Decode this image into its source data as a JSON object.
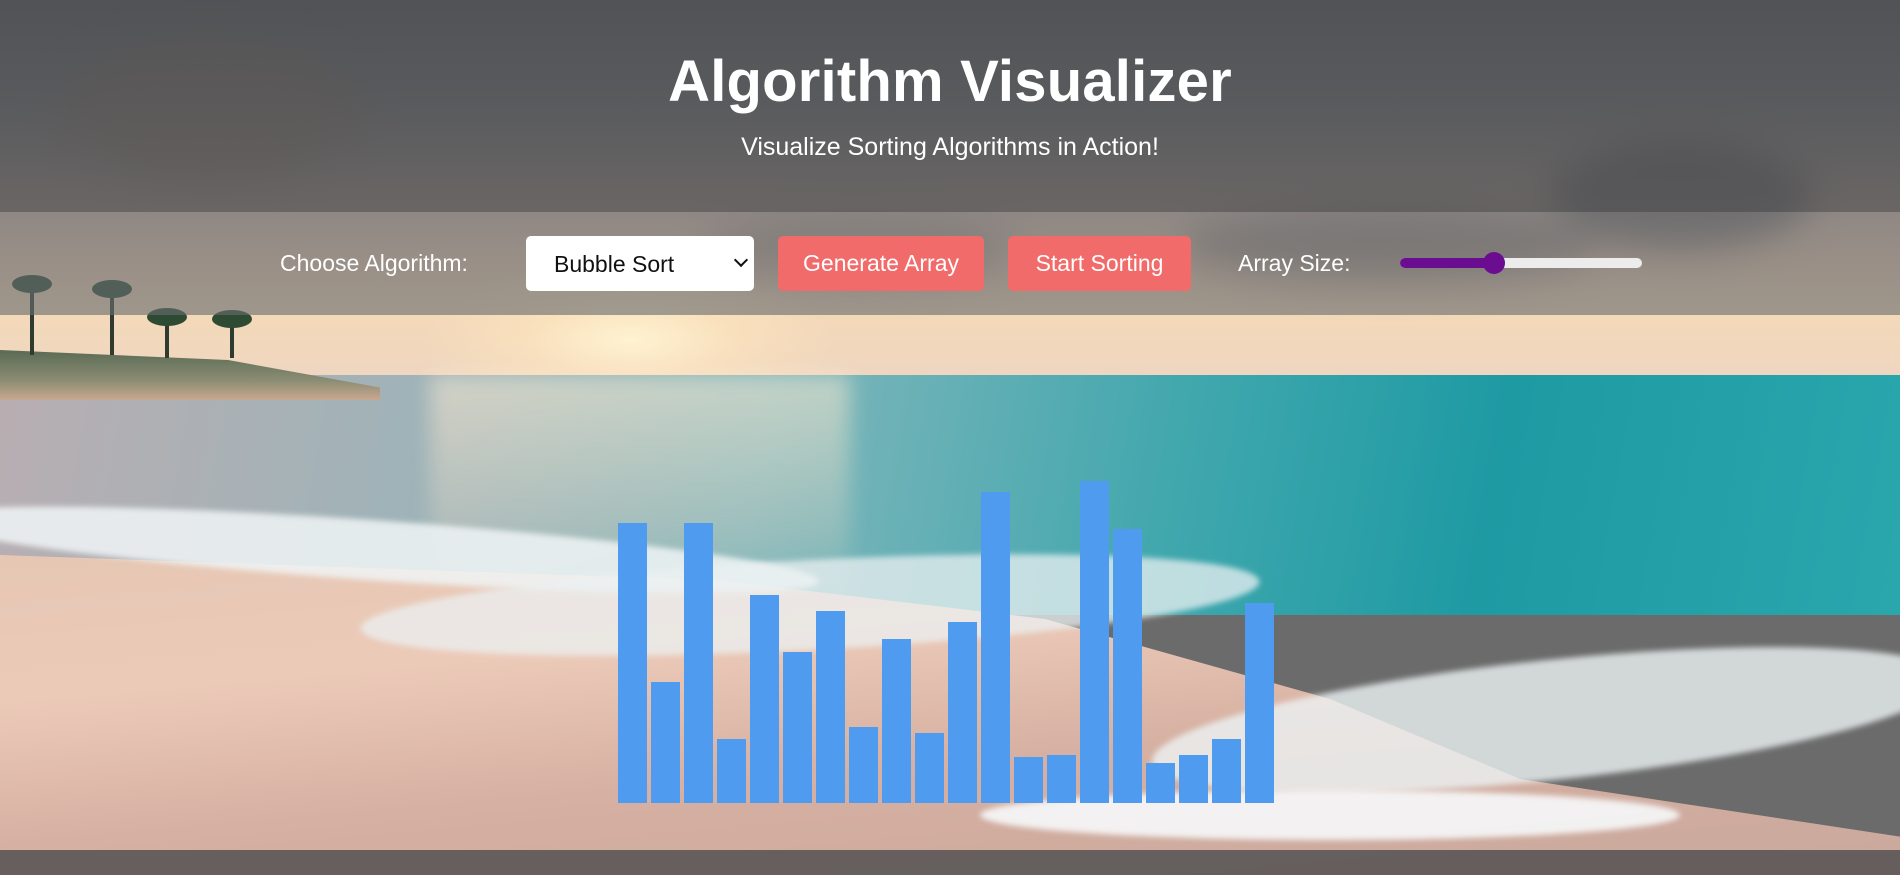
{
  "header": {
    "title": "Algorithm Visualizer",
    "subtitle": "Visualize Sorting Algorithms in Action!"
  },
  "controls": {
    "algorithm_label": "Choose Algorithm:",
    "algorithm_selected": "Bubble Sort",
    "generate_label": "Generate Array",
    "start_label": "Start Sorting",
    "size_label": "Array Size:",
    "size_fraction": 0.39
  },
  "colors": {
    "bar": "#4f9bef",
    "button": "#f26b6b",
    "slider": "#6a0d91"
  },
  "background": {
    "scene": "beach-sunset"
  },
  "chart_data": {
    "type": "bar",
    "values": [
      280,
      121,
      280,
      64,
      208,
      151,
      192,
      76,
      164,
      70,
      181,
      311,
      46,
      48,
      322,
      274,
      40,
      48,
      64,
      200
    ],
    "ylim": [
      0,
      333
    ]
  }
}
